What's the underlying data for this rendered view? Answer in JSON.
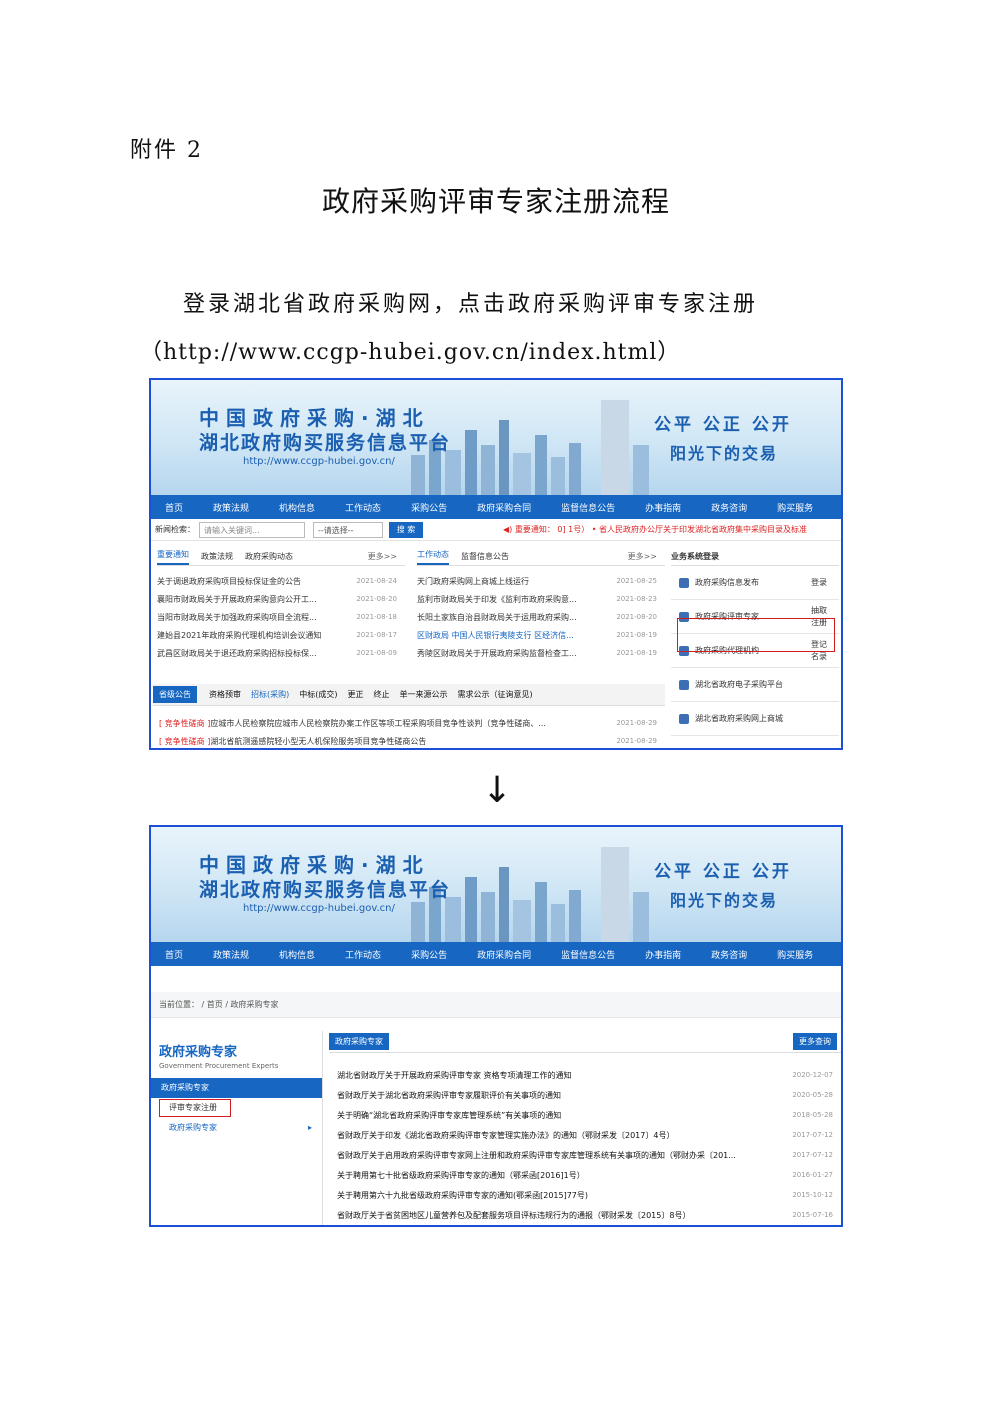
{
  "doc": {
    "attachment": "附件 2",
    "title": "政府采购评审专家注册流程",
    "line1": "登录湖北省政府采购网，点击政府采购评审专家注册",
    "line2": "（http://www.ccgp-hubei.gov.cn/index.html）",
    "arrow": "↓"
  },
  "banner": {
    "title1": "中国政府采购·湖北",
    "title2": "湖北政府购买服务信息平台",
    "url": "http://www.ccgp-hubei.gov.cn/",
    "slogan1": "公平 公正 公开",
    "slogan2": "阳光下的交易"
  },
  "nav": [
    "首页",
    "政策法规",
    "机构信息",
    "工作动态",
    "采购公告",
    "政府采购合同",
    "监督信息公告",
    "办事指南",
    "政务咨询",
    "购买服务"
  ],
  "search": {
    "label": "新闻检索：",
    "placeholder": "请输入关键词...",
    "select": "--请选择--",
    "button": "搜 索",
    "notice": "◀) 重要通知：  0] 1号）  • 省人民政府办公厅关于印发湖北省政府集中采购目录及标准"
  },
  "panel1": {
    "tabs": [
      "重要通知",
      "政策法规",
      "政府采购动态"
    ],
    "more": "更多>>",
    "rows": [
      {
        "t": "关于调退政府采购项目投标保证金的公告",
        "d": "2021-08-24"
      },
      {
        "t": "襄阳市财政局关于开展政府采购意向公开工...",
        "d": "2021-08-20"
      },
      {
        "t": "当阳市财政局关于加强政府采购项目全流程...",
        "d": "2021-08-18"
      },
      {
        "t": "建始县2021年政府采购代理机构培训会议通知",
        "d": "2021-08-17"
      },
      {
        "t": "武昌区财政局关于退还政府采购招标投标保...",
        "d": "2021-08-09"
      }
    ]
  },
  "panel2": {
    "tabs": [
      "工作动态",
      "监督信息公告"
    ],
    "more": "更多>>",
    "rows": [
      {
        "t": "天门政府采购网上商城上线运行",
        "d": "2021-08-25"
      },
      {
        "t": "监利市财政局关于印发《监利市政府采购意...",
        "d": "2021-08-23"
      },
      {
        "t": "长阳土家族自治县财政局关于运用政府采购...",
        "d": "2021-08-20"
      },
      {
        "t": "区财政局 中国人民银行夷陵支行 区经济信...",
        "d": "2021-08-19"
      },
      {
        "t": "秀陵区财政局关于开展政府采购监督检查工...",
        "d": "2021-08-19"
      }
    ]
  },
  "login": {
    "title": "业务系统登录",
    "items": [
      {
        "label": "政府采购信息发布",
        "action": "登录"
      },
      {
        "label": "政府采购评审专家",
        "action": "抽取\n注册"
      },
      {
        "label": "政府采购代理机构",
        "action": "登记\n名录"
      },
      {
        "label": "湖北省政府电子采购平台",
        "action": ""
      },
      {
        "label": "湖北省政府采购网上商城",
        "action": ""
      }
    ]
  },
  "bottom_tabs": [
    "省级公告",
    "资格预审",
    "招标(采购)",
    "中标(成交)",
    "更正",
    "终止",
    "单一来源公示",
    "需求公示（征询意见)"
  ],
  "bottom_rows": [
    {
      "tag": "[ 竞争性磋商 ]",
      "t": "应城市人民检察院应城市人民检察院办案工作区等项工程采购项目竞争性谈判（竞争性磋商、...",
      "d": "2021-08-29"
    },
    {
      "tag": "[ 竞争性磋商 ]",
      "t": "湖北省航测遥感院轻小型无人机保险服务项目竞争性磋商公告",
      "d": "2021-08-29"
    }
  ],
  "page2": {
    "crumb": "当前位置：  /  首页  /  政府采购专家",
    "left_title": "政府采购专家",
    "left_sub": "Government Procurement Experts",
    "left_bar": "政府采购专家",
    "left_items": [
      "评审专家注册",
      "政府采购专家"
    ],
    "right_head": "政府采购专家",
    "right_more": "更多查询",
    "rows": [
      {
        "t": "湖北省财政厅关于开展政府采购评审专家 资格专项清理工作的通知",
        "d": "2020-12-07"
      },
      {
        "t": "省财政厅关于湖北省政府采购评审专家履职评价有关事项的通知",
        "d": "2020-05-28"
      },
      {
        "t": "关于明确“湖北省政府采购评审专家库管理系统”有关事项的通知",
        "d": "2018-05-28"
      },
      {
        "t": "省财政厅关于印发《湖北省政府采购评审专家管理实施办法》的通知（鄂财采发〔2017〕4号）",
        "d": "2017-07-12"
      },
      {
        "t": "省财政厅关于启用政府采购评审专家网上注册和政府采购评审专家库管理系统有关事项的通知（鄂财办采〔201...",
        "d": "2017-07-12"
      },
      {
        "t": "关于聘用第七十批省级政府采购评审专家的通知（鄂采函[2016]1号）",
        "d": "2016-01-27"
      },
      {
        "t": "关于聘用第六十九批省级政府采购评审专家的通知(鄂采函[2015]77号)",
        "d": "2015-10-12"
      },
      {
        "t": "省财政厅关于省贫困地区儿童营养包及配套服务项目评标违规行为的通报（鄂财采发〔2015〕8号）",
        "d": "2015-07-16"
      }
    ]
  }
}
